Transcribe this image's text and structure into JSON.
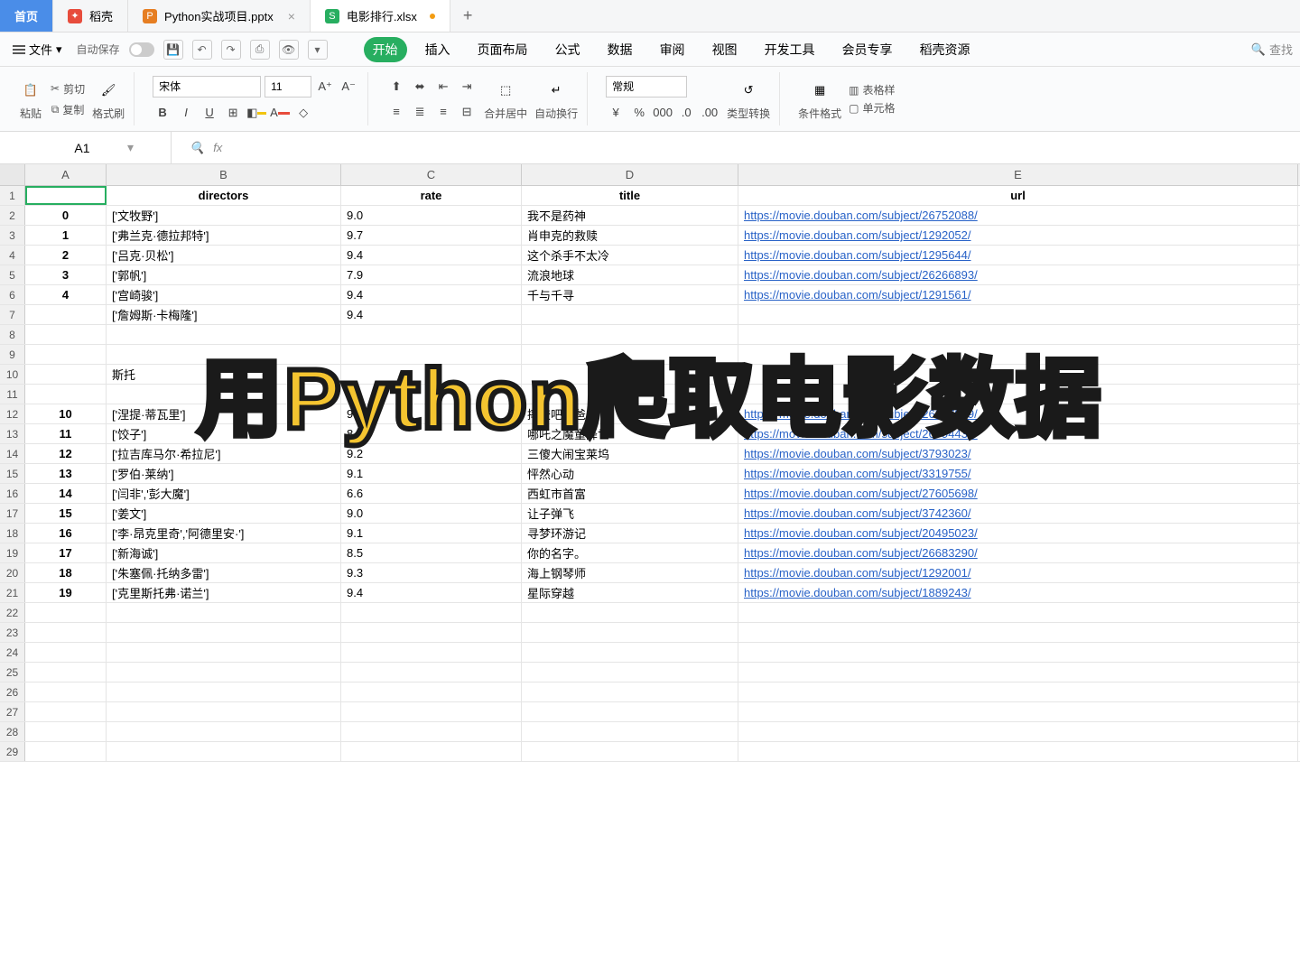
{
  "tabs": {
    "home": "首页",
    "t1": "稻壳",
    "t2": "Python实战项目.pptx",
    "t3": "电影排行.xlsx",
    "add": "+"
  },
  "menu": {
    "file": "文件",
    "autosave": "自动保存"
  },
  "ribbon_tabs": [
    "开始",
    "插入",
    "页面布局",
    "公式",
    "数据",
    "审阅",
    "视图",
    "开发工具",
    "会员专享",
    "稻壳资源"
  ],
  "search_hint": "查找",
  "ribbon": {
    "paste": "粘贴",
    "cut": "剪切",
    "copy": "复制",
    "fmt_painter": "格式刷",
    "font_name": "宋体",
    "font_size": "11",
    "merge": "合并居中",
    "wrap": "自动换行",
    "number_fmt": "常规",
    "type_conv": "类型转换",
    "cond_fmt": "条件格式",
    "tbl_style": "表格样",
    "cell_style": "单元格"
  },
  "name_box": "A1",
  "fx": "fx",
  "columns": [
    "A",
    "B",
    "C",
    "D",
    "E"
  ],
  "headers": {
    "a": "",
    "b": "directors",
    "c": "rate",
    "d": "title",
    "e": "url"
  },
  "rows": [
    {
      "n": "2",
      "a": "0",
      "b": "['文牧野']",
      "c": "9.0",
      "d": "我不是药神",
      "e": "https://movie.douban.com/subject/26752088/"
    },
    {
      "n": "3",
      "a": "1",
      "b": "['弗兰克·德拉邦特']",
      "c": "9.7",
      "d": "肖申克的救赎",
      "e": "https://movie.douban.com/subject/1292052/"
    },
    {
      "n": "4",
      "a": "2",
      "b": "['吕克·贝松']",
      "c": "9.4",
      "d": "这个杀手不太冷",
      "e": "https://movie.douban.com/subject/1295644/"
    },
    {
      "n": "5",
      "a": "3",
      "b": "['郭帆']",
      "c": "7.9",
      "d": "流浪地球",
      "e": "https://movie.douban.com/subject/26266893/"
    },
    {
      "n": "6",
      "a": "4",
      "b": "['宫崎骏']",
      "c": "9.4",
      "d": "千与千寻",
      "e": "https://movie.douban.com/subject/1291561/"
    },
    {
      "n": "7",
      "a": "",
      "b": "['詹姆斯·卡梅隆']",
      "c": "9.4",
      "d": "",
      "e": ""
    },
    {
      "n": "8",
      "a": "",
      "b": "",
      "c": "",
      "d": "",
      "e": ""
    },
    {
      "n": "9",
      "a": "",
      "b": "",
      "c": "",
      "d": "",
      "e": ""
    },
    {
      "n": "10",
      "a": "",
      "b": "斯托",
      "c": "",
      "d": "",
      "e": ""
    },
    {
      "n": "11",
      "a": "",
      "b": "",
      "c": "",
      "d": "",
      "e": ""
    },
    {
      "n": "12",
      "a": "10",
      "b": "['涅提·蒂瓦里']",
      "c": "9.0",
      "d": "摔跤吧！爸爸",
      "e": "https://movie.douban.com/subject/26387939/"
    },
    {
      "n": "13",
      "a": "11",
      "b": "['饺子']",
      "c": "8.4",
      "d": "哪吒之魔童降世",
      "e": "https://movie.douban.com/subject/26794435/"
    },
    {
      "n": "14",
      "a": "12",
      "b": "['拉吉库马尔·希拉尼']",
      "c": "9.2",
      "d": "三傻大闹宝莱坞",
      "e": "https://movie.douban.com/subject/3793023/"
    },
    {
      "n": "15",
      "a": "13",
      "b": "['罗伯·莱纳']",
      "c": "9.1",
      "d": "怦然心动",
      "e": "https://movie.douban.com/subject/3319755/"
    },
    {
      "n": "16",
      "a": "14",
      "b": "['闫非','彭大魔']",
      "c": "6.6",
      "d": "西虹市首富",
      "e": "https://movie.douban.com/subject/27605698/"
    },
    {
      "n": "17",
      "a": "15",
      "b": "['姜文']",
      "c": "9.0",
      "d": "让子弹飞",
      "e": "https://movie.douban.com/subject/3742360/"
    },
    {
      "n": "18",
      "a": "16",
      "b": "['李·昂克里奇','阿德里安·']",
      "c": "9.1",
      "d": "寻梦环游记",
      "e": "https://movie.douban.com/subject/20495023/"
    },
    {
      "n": "19",
      "a": "17",
      "b": "['新海诚']",
      "c": "8.5",
      "d": "你的名字。",
      "e": "https://movie.douban.com/subject/26683290/"
    },
    {
      "n": "20",
      "a": "18",
      "b": "['朱塞佩·托纳多雷']",
      "c": "9.3",
      "d": "海上钢琴师",
      "e": "https://movie.douban.com/subject/1292001/"
    },
    {
      "n": "21",
      "a": "19",
      "b": "['克里斯托弗·诺兰']",
      "c": "9.4",
      "d": "星际穿越",
      "e": "https://movie.douban.com/subject/1889243/"
    }
  ],
  "empty_rows": [
    "22",
    "23",
    "24",
    "25",
    "26",
    "27",
    "28",
    "29"
  ],
  "overlay": "用Python爬取电影数据"
}
